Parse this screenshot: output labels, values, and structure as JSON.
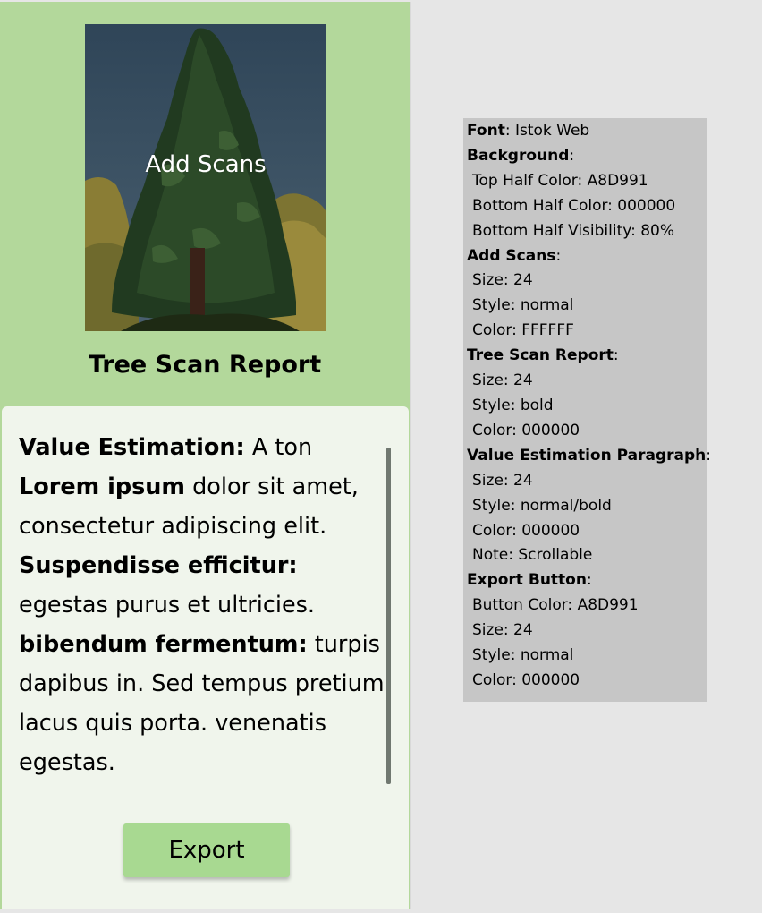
{
  "colors": {
    "top_half": "#A8D991",
    "bottom_half": "#F0F5EC",
    "button": "#A8D991",
    "spec_panel": "#C6C6C6"
  },
  "scan": {
    "add_scans_label": "Add Scans",
    "image_subject": "tree-photo"
  },
  "report": {
    "title": "Tree Scan Report",
    "paragraph": [
      {
        "bold": "Value Estimation:",
        "text": " A ton"
      },
      {
        "bold": "Lorem ipsum",
        "text": " dolor sit amet, consectetur adipiscing elit."
      },
      {
        "bold": "Suspendisse efficitur:",
        "text": " egestas purus et ultricies."
      },
      {
        "bold": "bibendum fermentum:",
        "text": " turpis dapibus in. Sed tempus pretium lacus quis porta. venenatis egestas."
      }
    ]
  },
  "export_button": {
    "label": "Export"
  },
  "spec": {
    "font_key": "Font",
    "font_value": ": Istok Web",
    "background_key": "Background",
    "background_items": [
      "Top Half Color: A8D991",
      "Bottom Half Color: 000000",
      "Bottom Half Visibility: 80%"
    ],
    "add_scans_key": "Add Scans",
    "add_scans_items": [
      "Size: 24",
      "Style: normal",
      "Color: FFFFFF"
    ],
    "tree_report_key": "Tree Scan Report",
    "tree_report_items": [
      "Size: 24",
      "Style: bold",
      "Color: 000000"
    ],
    "value_para_key": "Value Estimation Paragraph",
    "value_para_items": [
      "Size: 24",
      "Style: normal/bold",
      "Color: 000000",
      "Note: Scrollable"
    ],
    "export_key": "Export Button",
    "export_items": [
      "Button Color: A8D991",
      "Size: 24",
      "Style: normal",
      "Color: 000000"
    ]
  }
}
